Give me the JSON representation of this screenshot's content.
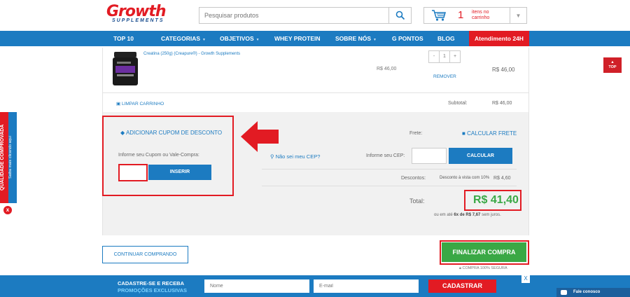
{
  "brand": {
    "logo_main": "Growth",
    "logo_sub": "SUPPLEMENTS"
  },
  "search": {
    "placeholder": "Pesquisar produtos"
  },
  "cart_widget": {
    "count": "1",
    "text": "itens no carrinho"
  },
  "nav": {
    "items": [
      {
        "label": "TOP 10"
      },
      {
        "label": "CATEGORIAS"
      },
      {
        "label": "OBJETIVOS"
      },
      {
        "label": "WHEY PROTEIN"
      },
      {
        "label": "SOBRE NÓS"
      },
      {
        "label": "G PONTOS"
      },
      {
        "label": "BLOG"
      }
    ],
    "atendimento": "Atendimento 24H"
  },
  "product": {
    "name": "Creatina (250g) (Creapure®) - Growth Supplements",
    "unit_price": "R$ 46,00",
    "quantity": "1",
    "qty_minus": "-",
    "qty_plus": "+",
    "remove_label": "REMOVER",
    "line_total": "R$ 46,00"
  },
  "cart": {
    "clear_label": "LIMPAR CARRINHO",
    "subtotal_label": "Subtotal:",
    "subtotal_value": "R$ 46,00"
  },
  "coupon": {
    "toggle_label": "ADICIONAR CUPOM DE DESCONTO",
    "field_label": "Informe seu Cupom ou Vale-Compra:",
    "apply_label": "INSERIR"
  },
  "shipping": {
    "label": "Frete:",
    "calc_link": "CALCULAR FRETE",
    "unknown_cep_link": "Não sei meu CEP?",
    "cep_label": "Informe seu CEP:",
    "calc_button": "CALCULAR"
  },
  "discounts": {
    "label": "Descontos:",
    "text": "Desconto à vista com 10%",
    "value": "R$ 4,60"
  },
  "total": {
    "label": "Total:",
    "value": "R$ 41,40",
    "installments_prefix": "ou em até",
    "installments_value": "6x de R$ 7,67",
    "installments_suffix": "sem juros."
  },
  "actions": {
    "continue_label": "CONTINUAR COMPRANDO",
    "checkout_label": "FINALIZAR COMPRA",
    "secure_label": "COMPRA 100% SEGURA"
  },
  "newsletter": {
    "line1": "CADASTRE-SE E RECEBA",
    "line2": "PROMOÇÕES EXCLUSIVAS",
    "name_placeholder": "Nome",
    "email_placeholder": "E-mail",
    "submit_label": "CADASTRAR",
    "close_label": "X"
  },
  "chat": {
    "label": "Fale conosco"
  },
  "side_badge": {
    "title": "QUALIDADE COMPROVADA",
    "subtitle": "Saiba mais clicando aqui",
    "close_label": "x"
  },
  "top_button": {
    "label": "TOP"
  },
  "colors": {
    "brand_blue": "#1c7bc1",
    "brand_red": "#e21b23",
    "success_green": "#3aa845"
  }
}
